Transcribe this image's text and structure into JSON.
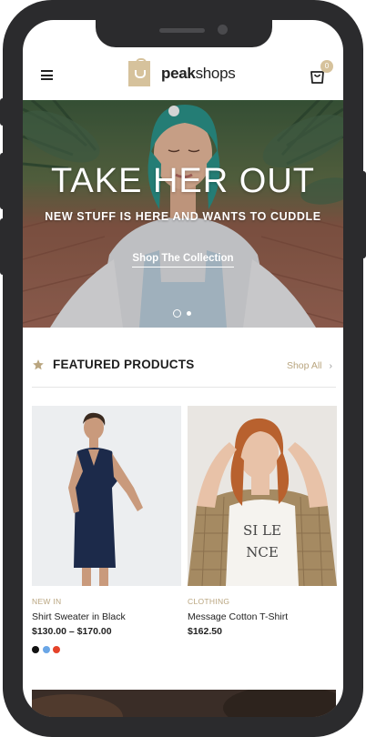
{
  "header": {
    "logo_prefix": "peak",
    "logo_suffix": "shops",
    "cart_count": "0"
  },
  "hero": {
    "title": "TAKE HER OUT",
    "subtitle": "NEW STUFF IS HERE AND WANTS TO CUDDLE",
    "cta": "Shop The Collection",
    "slides": 2,
    "active_slide": 1
  },
  "section": {
    "title": "FEATURED PRODUCTS",
    "link": "Shop All",
    "chevron": "›"
  },
  "products": [
    {
      "category": "NEW IN",
      "name": "Shirt Sweater in Black",
      "price": "$130.00 – $170.00",
      "swatches": [
        "#111111",
        "#6aa6e6",
        "#e5432a"
      ]
    },
    {
      "category": "CLOTHING",
      "name": "Message Cotton T-Shirt",
      "price": "$162.50",
      "shirt_text": "SI LE NCE"
    }
  ],
  "colors": {
    "accent": "#b9a57f",
    "logo_gold": "#d6c29c",
    "frame": "#2b2b2d"
  },
  "icons": [
    "hamburger-icon",
    "shopping-bag-icon",
    "star-icon",
    "chevron-right-icon"
  ]
}
